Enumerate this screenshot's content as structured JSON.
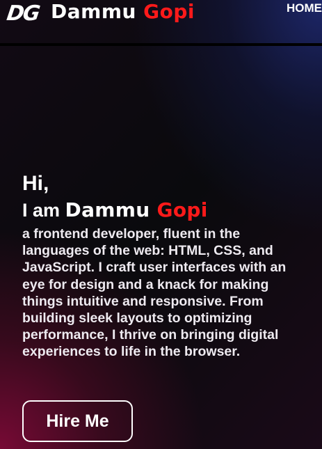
{
  "header": {
    "logo_mark": "DG",
    "logo_first": "Dammu",
    "logo_last": "Gopi",
    "nav_home": "HOME"
  },
  "hero": {
    "greeting": "Hi,",
    "intro_prefix": "I am",
    "name_first": "Dammu",
    "name_last": "Gopi",
    "description": "a frontend developer, fluent in the languages of the web: HTML, CSS, and JavaScript. I craft user interfaces with an eye for design and a knack for making things intuitive and responsive. From building sleek layouts to optimizing performance, I thrive on bringing digital experiences to life in the browser.",
    "cta_label": "Hire Me"
  },
  "colors": {
    "accent": "#ff1a1a",
    "text": "#ffffff",
    "bg_pink": "#7d0a37",
    "bg_blue": "#1e286e"
  }
}
